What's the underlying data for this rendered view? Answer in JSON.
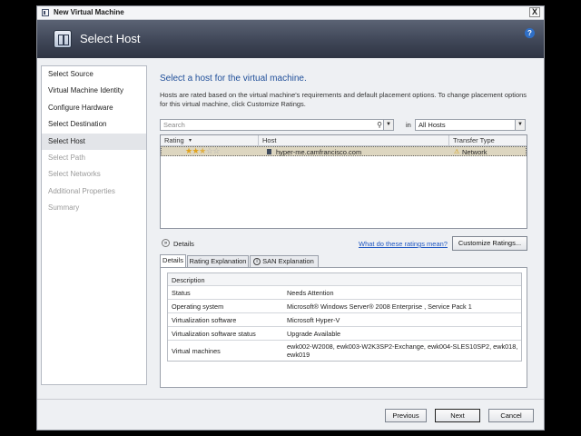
{
  "window": {
    "title": "New Virtual Machine",
    "close_glyph": "X"
  },
  "banner": {
    "title": "Select Host",
    "help_glyph": "?"
  },
  "nav": {
    "items": [
      {
        "label": "Select Source",
        "state": "enabled"
      },
      {
        "label": "Virtual Machine Identity",
        "state": "enabled"
      },
      {
        "label": "Configure Hardware",
        "state": "enabled"
      },
      {
        "label": "Select Destination",
        "state": "enabled"
      },
      {
        "label": "Select Host",
        "state": "active"
      },
      {
        "label": "Select Path",
        "state": "disabled"
      },
      {
        "label": "Select Networks",
        "state": "disabled"
      },
      {
        "label": "Additional Properties",
        "state": "disabled"
      },
      {
        "label": "Summary",
        "state": "disabled"
      }
    ]
  },
  "main": {
    "heading": "Select a host for the virtual machine.",
    "description": "Hosts are rated based on the virtual machine's requirements and default placement options. To change placement options for this virtual machine, click Customize Ratings.",
    "search": {
      "placeholder": "Search"
    },
    "in_label": "in",
    "filter": {
      "value": "All Hosts"
    },
    "grid": {
      "columns": [
        "Rating",
        "Host",
        "Transfer Type"
      ],
      "rows": [
        {
          "rating_stars": 2.5,
          "rating_max": 5,
          "host": "hyper-me.camfrancisco.com",
          "transfer": "Network"
        }
      ]
    },
    "details_toggle": "Details",
    "ratings_link": "What do these ratings mean?",
    "customize_button": "Customize Ratings...",
    "tabs": [
      "Details",
      "Rating Explanation",
      "SAN Explanation"
    ],
    "details_table": {
      "header": "Description",
      "rows": [
        {
          "key": "Status",
          "value": "Needs Attention"
        },
        {
          "key": "Operating system",
          "value": "Microsoft® Windows Server® 2008 Enterprise , Service Pack 1"
        },
        {
          "key": "Virtualization software",
          "value": "Microsoft Hyper-V"
        },
        {
          "key": "Virtualization software status",
          "value": "Upgrade Available"
        },
        {
          "key": "Virtual machines",
          "value": "ewk002-W2008, ewk003-W2K3SP2-Exchange, ewk004-SLES10SP2, ewk018, ewk019"
        }
      ]
    }
  },
  "footer": {
    "previous": "Previous",
    "next": "Next",
    "cancel": "Cancel"
  },
  "colors": {
    "heading": "#1f4e99",
    "link": "#1f57c2",
    "selected_row": "#ddd6c0",
    "banner": "#3d4455",
    "star": "#e0a21c"
  }
}
